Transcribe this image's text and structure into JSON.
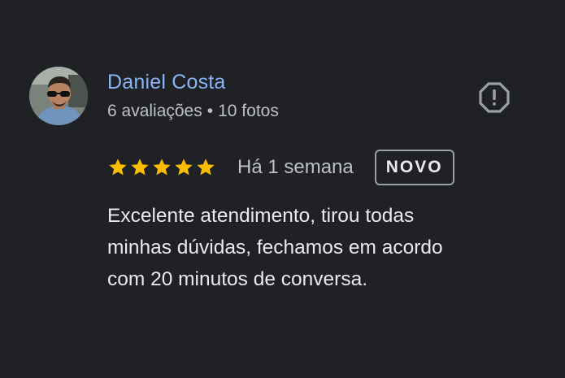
{
  "review": {
    "author": {
      "name": "Daniel Costa",
      "reviews_count": "6 avaliações",
      "separator": "•",
      "photos_count": "10 fotos"
    },
    "rating": 5,
    "rating_max": 5,
    "date": "Há 1 semana",
    "badge": "NOVO",
    "text_lines": [
      "Excelente atendimento, tirou todas",
      "minhas dúvidas, fechamos em acordo",
      "com 20 minutos de conversa."
    ]
  },
  "icons": {
    "report": "report-flag-icon",
    "star": "star-icon",
    "avatar": "user-avatar"
  },
  "colors": {
    "background": "#202124",
    "author_name": "#8ab4f8",
    "star": "#fbbc04",
    "meta_text": "#bdc1c6",
    "body_text": "#e8eaed",
    "badge_border": "#9aa0a6"
  }
}
